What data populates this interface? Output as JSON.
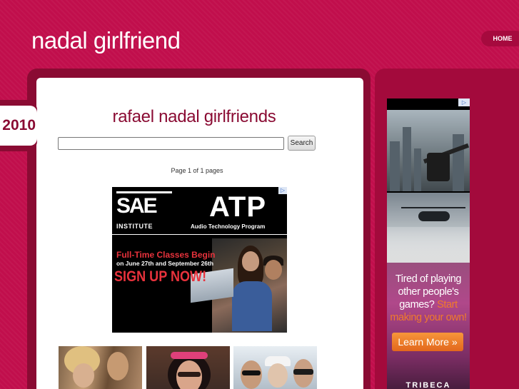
{
  "site": {
    "title": "nadal girlfriend",
    "nav_home": "HOME",
    "year_tab": "2010"
  },
  "main": {
    "heading": "rafael nadal girlfriends",
    "search": {
      "value": "",
      "button_label": "Search"
    },
    "page_count": "Page 1 of 1 pages"
  },
  "ad_banner": {
    "badge": "▷",
    "logo_text": "SAE",
    "logo_sub": "INSTITUTE",
    "atp": "ATP",
    "atp_sub": "Audio Technology Program",
    "line1": "Full-Time Classes Begin",
    "line2": "on June 27th and September 26th",
    "line3": "SIGN UP NOW!"
  },
  "sidebar_ad": {
    "badge": "▷",
    "text_pre": "Tired of playing other people's games?",
    "text_accent": "Start making your own!",
    "button_label": "Learn More »",
    "brand": "TRIBECA"
  },
  "colors": {
    "background": "#c10e4c",
    "frame": "#8a0b33",
    "heading": "#8a0b33",
    "cta": "#e2671d"
  }
}
